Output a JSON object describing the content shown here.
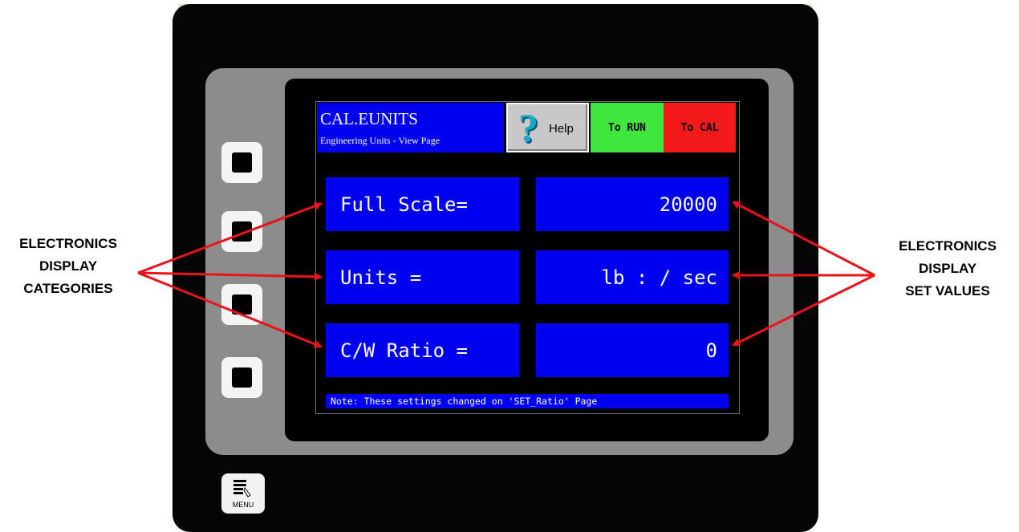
{
  "hmi": {
    "title": "CAL.EUNITS",
    "subtitle": "Engineering Units - View Page",
    "buttons": {
      "help": "Help",
      "to_run": "To RUN",
      "to_cal": "To CAL"
    },
    "rows": [
      {
        "label": "Full Scale=",
        "value": "20000"
      },
      {
        "label": "Units =",
        "value": "lb : / sec"
      },
      {
        "label": "C/W Ratio =",
        "value": "0"
      }
    ],
    "note": "Note: These settings changed on 'SET_Ratio' Page"
  },
  "device": {
    "menu_label": "MENU"
  },
  "annotations": {
    "left": [
      "ELECTRONICS",
      "DISPLAY",
      "CATEGORIES"
    ],
    "right": [
      "ELECTRONICS",
      "DISPLAY",
      "SET VALUES"
    ]
  },
  "colors": {
    "screen_blue": "#0000f0",
    "run_green": "#3ee63e",
    "cal_red": "#f21a1a",
    "arrow_red": "#e8141a"
  },
  "icons": {
    "help": "question-mark-icon",
    "menu": "menu-list-icon"
  }
}
